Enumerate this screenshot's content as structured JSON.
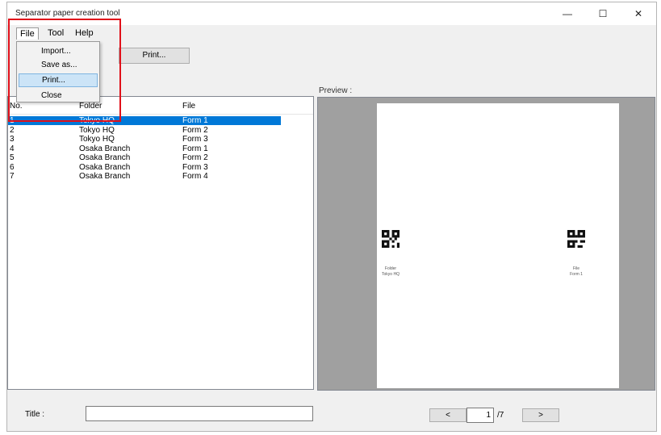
{
  "window": {
    "title": "Separator paper creation tool",
    "minimize_glyph": "—",
    "maximize_glyph": "☐",
    "close_glyph": "✕"
  },
  "menubar": {
    "file": "File",
    "tool": "Tool",
    "help": "Help"
  },
  "file_menu": {
    "items": [
      "Import...",
      "Save as...",
      "Print...",
      "Close"
    ],
    "highlighted": "Print..."
  },
  "toolbar": {
    "print_label": "Print..."
  },
  "list": {
    "headers": {
      "no": "No.",
      "folder": "Folder",
      "file": "File"
    },
    "rows": [
      {
        "no": "1",
        "folder": "Tokyo HQ",
        "file": "Form 1",
        "selected": true
      },
      {
        "no": "2",
        "folder": "Tokyo HQ",
        "file": "Form 2"
      },
      {
        "no": "3",
        "folder": "Tokyo HQ",
        "file": "Form 3"
      },
      {
        "no": "4",
        "folder": "Osaka Branch",
        "file": "Form 1"
      },
      {
        "no": "5",
        "folder": "Osaka Branch",
        "file": "Form 2"
      },
      {
        "no": "6",
        "folder": "Osaka Branch",
        "file": "Form 3"
      },
      {
        "no": "7",
        "folder": "Osaka Branch",
        "file": "Form 4"
      }
    ]
  },
  "preview": {
    "label": "Preview :",
    "left_caption": {
      "line1": "Folder",
      "line2": "Tokyo HQ"
    },
    "right_caption": {
      "line1": "File",
      "line2": "Form 1"
    }
  },
  "footer": {
    "title_label": "Title :",
    "title_value": "",
    "prev_label": "<",
    "next_label": ">",
    "page_current": "1",
    "page_total": "/7"
  },
  "colors": {
    "selection": "#0078d7",
    "highlight_box": "#e0101a",
    "preview_bg": "#a0a0a0"
  }
}
